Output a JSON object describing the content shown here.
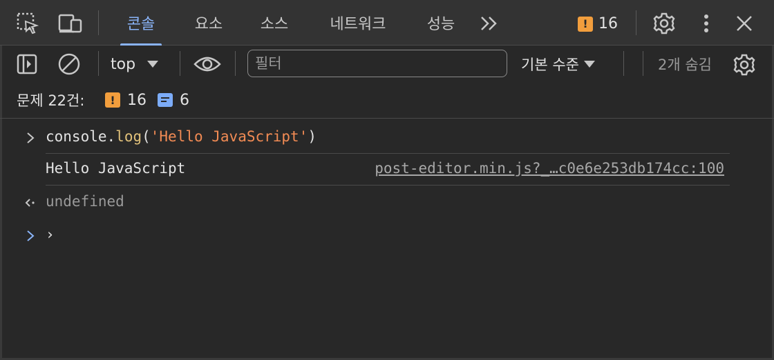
{
  "tabs": [
    {
      "label": "콘솔",
      "active": true
    },
    {
      "label": "요소",
      "active": false
    },
    {
      "label": "소스",
      "active": false
    },
    {
      "label": "네트워크",
      "active": false
    },
    {
      "label": "성능",
      "active": false
    }
  ],
  "top_bar": {
    "more_tabs_icon": "double-chevron-right-icon",
    "issues_count": "16",
    "settings_icon": "gear-icon",
    "menu_icon": "kebab-icon",
    "close_icon": "close-icon"
  },
  "toolbar": {
    "context": "top",
    "filter_placeholder": "필터",
    "filter_value": "",
    "level": "기본 수준",
    "hidden": "2개 숨김"
  },
  "issues": {
    "label": "문제 22건:",
    "warnings": "16",
    "info": "6"
  },
  "console": {
    "command": {
      "obj": "console",
      "dot": ".",
      "method": "log",
      "open": "(",
      "arg": "'Hello JavaScript'",
      "close": ")"
    },
    "log_output": "Hello JavaScript",
    "log_source": "post-editor.min.js?_…c0e6e253db174cc:100",
    "result": "undefined",
    "prompt_caret": "›"
  },
  "colors": {
    "accent": "#8ab4f8",
    "warning": "#f29e3d",
    "info": "#7cacf8",
    "string": "#f28b54",
    "function": "#e1c17a"
  }
}
